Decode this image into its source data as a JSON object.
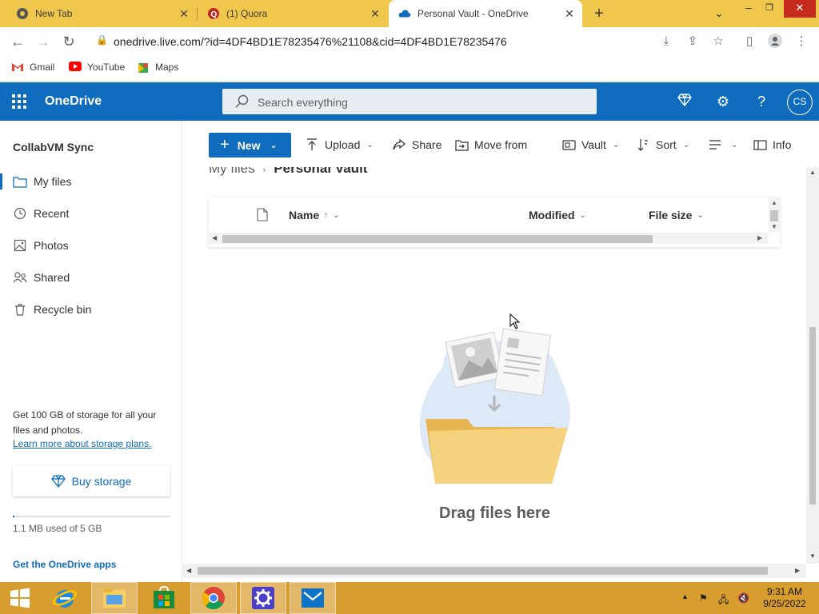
{
  "browser": {
    "tabs": [
      {
        "title": "New Tab"
      },
      {
        "title": "(1) Quora"
      },
      {
        "title": "Personal Vault - OneDrive"
      }
    ],
    "url": "onedrive.live.com/?id=4DF4BD1E78235476%21108&cid=4DF4BD1E78235476",
    "bookmarks": [
      {
        "label": "Gmail"
      },
      {
        "label": "YouTube"
      },
      {
        "label": "Maps"
      }
    ]
  },
  "header": {
    "brand": "OneDrive",
    "search_placeholder": "Search everything",
    "avatar_initials": "CS"
  },
  "sidebar": {
    "account_name": "CollabVM Sync",
    "items": [
      {
        "label": "My files",
        "icon": "folder-icon",
        "selected": true
      },
      {
        "label": "Recent",
        "icon": "clock-icon"
      },
      {
        "label": "Photos",
        "icon": "photo-icon"
      },
      {
        "label": "Shared",
        "icon": "people-icon"
      },
      {
        "label": "Recycle bin",
        "icon": "trash-icon"
      }
    ],
    "storage_text": "Get 100 GB of storage for all your files and photos.",
    "storage_link": "Learn more about storage plans.",
    "buy_storage": "Buy storage",
    "usage_text": "1.1 MB used of 5 GB",
    "usage_fraction": 0.0002,
    "get_apps": "Get the OneDrive apps"
  },
  "commandbar": {
    "new": "New",
    "upload": "Upload",
    "share": "Share",
    "move_from": "Move from",
    "vault": "Vault",
    "sort": "Sort",
    "info": "Info"
  },
  "breadcrumb": {
    "root": "My files",
    "current": "Personal Vault"
  },
  "list": {
    "columns": {
      "name": "Name",
      "modified": "Modified",
      "file_size": "File size"
    }
  },
  "empty_state": "Drag files here",
  "taskbar": {
    "time": "9:31 AM",
    "date": "9/25/2022"
  },
  "colors": {
    "brand_blue": "#0f6cbd",
    "tabstrip": "#f0c74d",
    "taskbar": "#d89d2f"
  }
}
